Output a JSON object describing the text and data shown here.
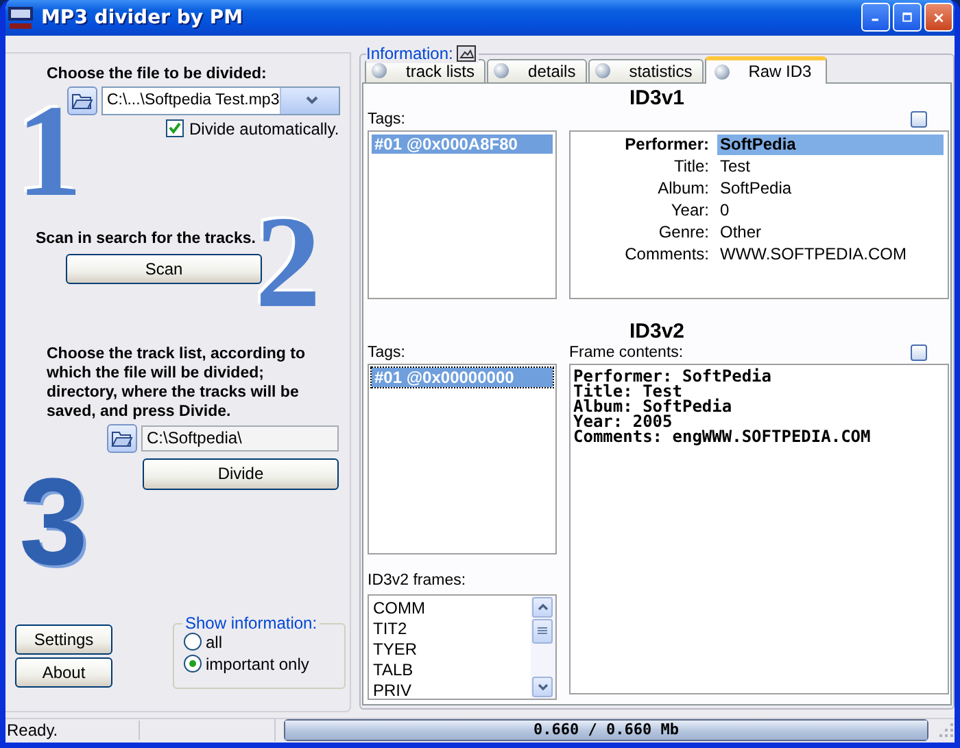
{
  "window": {
    "title": "MP3 divider by PM"
  },
  "file_step": {
    "number": "1",
    "label": "Choose the file to be divided:",
    "file": "C:\\...\\Softpedia Test.mp3",
    "divide_automatically": {
      "label": "Divide automatically.",
      "checked": true
    }
  },
  "scan_step": {
    "number": "2",
    "label": "Scan in search for the tracks.",
    "button": "Scan"
  },
  "divide_step": {
    "number": "3",
    "label": "Choose the track list, according to which the file will be divided; directory, where the tracks will be saved, and press Divide.",
    "directory": "C:\\Softpedia\\",
    "button": "Divide"
  },
  "buttons": [
    "Settings",
    "About"
  ],
  "show_information": {
    "label": "Show information:",
    "options": [
      {
        "label": "all",
        "selected": false
      },
      {
        "label": "important only",
        "selected": true
      }
    ]
  },
  "information": {
    "label": "Information:",
    "tabs": [
      {
        "label": "track lists",
        "selected": false
      },
      {
        "label": "details",
        "selected": false
      },
      {
        "label": "statistics",
        "selected": false
      },
      {
        "label": "Raw ID3",
        "selected": true
      }
    ],
    "id3v1": {
      "title": "ID3v1",
      "tags_label": "Tags:",
      "tags": [
        {
          "label": "#01 @0x000A8F80",
          "selected": true
        }
      ],
      "fields": [
        {
          "name": "Performer:",
          "value": "SoftPedia",
          "selected": true
        },
        {
          "name": "Title:",
          "value": "Test",
          "selected": false
        },
        {
          "name": "Album:",
          "value": "SoftPedia",
          "selected": false
        },
        {
          "name": "Year:",
          "value": "0",
          "selected": false
        },
        {
          "name": "Genre:",
          "value": "Other",
          "selected": false
        },
        {
          "name": "Comments:",
          "value": "WWW.SOFTPEDIA.COM",
          "selected": false
        }
      ]
    },
    "id3v2": {
      "title": "ID3v2",
      "tags_label": "Tags:",
      "tags": [
        {
          "label": "#01 @0x00000000",
          "selected": true
        }
      ],
      "frame_contents_label": "Frame contents:",
      "frame_contents": [
        "Performer: SoftPedia",
        "Title: Test",
        "Album: SoftPedia",
        "Year: 2005",
        "Comments: engWWW.SOFTPEDIA.COM"
      ],
      "frames_label": "ID3v2 frames:",
      "frames": [
        "COMM",
        "TIT2",
        "TYER",
        "TALB",
        "PRIV"
      ]
    }
  },
  "status_bar": {
    "text": "Ready.",
    "progress": {
      "level": 1,
      "reading": "0.660 / 0.660 Mb"
    }
  }
}
